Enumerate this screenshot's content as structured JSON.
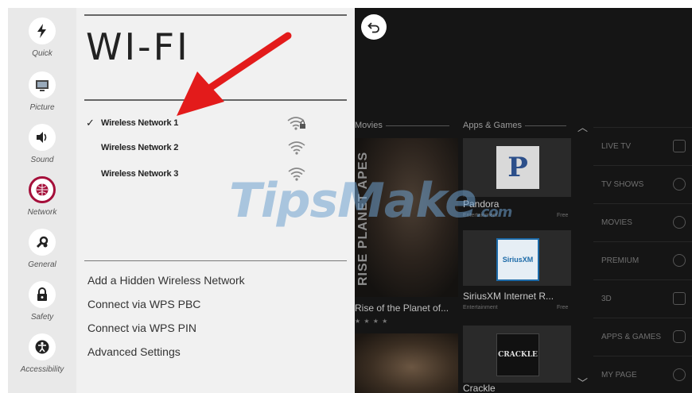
{
  "rail": {
    "items": [
      {
        "label": "Quick",
        "icon": "lightning-icon"
      },
      {
        "label": "Picture",
        "icon": "picture-icon"
      },
      {
        "label": "Sound",
        "icon": "sound-icon"
      },
      {
        "label": "Network",
        "icon": "network-globe-icon"
      },
      {
        "label": "General",
        "icon": "general-gear-icon"
      },
      {
        "label": "Safety",
        "icon": "lock-icon"
      },
      {
        "label": "Accessibility",
        "icon": "accessibility-icon"
      }
    ],
    "active": "Network",
    "active_color": "#a50f3a"
  },
  "panel": {
    "title": "WI-FI",
    "networks": [
      {
        "name": "Wireless Network 1",
        "connected": true,
        "check": "✓",
        "secured": true
      },
      {
        "name": "Wireless Network 2",
        "connected": false,
        "check": "",
        "secured": false
      },
      {
        "name": "Wireless Network 3",
        "connected": false,
        "check": "",
        "secured": false
      }
    ],
    "options": [
      "Add a Hidden Wireless Network",
      "Connect via WPS PBC",
      "Connect via WPS PIN",
      "Advanced Settings"
    ]
  },
  "home": {
    "movies_header": "Movies",
    "apps_header": "Apps & Games",
    "movie_poster_text": "RISE PLANET APES",
    "movie_title": "Rise of the Planet of...",
    "stars": "★ ★ ★ ★",
    "apps": [
      {
        "name": "Pandora",
        "category": "Entertainment",
        "type": "Free",
        "logo": "P"
      },
      {
        "name": "SiriusXM Internet R...",
        "category": "Entertainment",
        "type": "Free",
        "logo": "SiriusXM"
      },
      {
        "name": "Crackle",
        "category": "",
        "type": "",
        "logo": "CRACKLE"
      }
    ],
    "menu": [
      {
        "label": "LIVE TV",
        "icon": "tv-icon"
      },
      {
        "label": "TV SHOWS",
        "icon": "play-icon"
      },
      {
        "label": "MOVIES",
        "icon": "film-icon"
      },
      {
        "label": "PREMIUM",
        "icon": "premium-icon"
      },
      {
        "label": "3D",
        "icon": "3d-icon"
      },
      {
        "label": "APPS & GAMES",
        "icon": "gamepad-icon"
      },
      {
        "label": "MY PAGE",
        "icon": "info-icon"
      }
    ]
  },
  "annotation": {
    "arrow_color": "#e31b1b"
  },
  "watermark": {
    "text": "TipsMake",
    "suffix": ".com",
    "color": "#6ea0cd"
  }
}
